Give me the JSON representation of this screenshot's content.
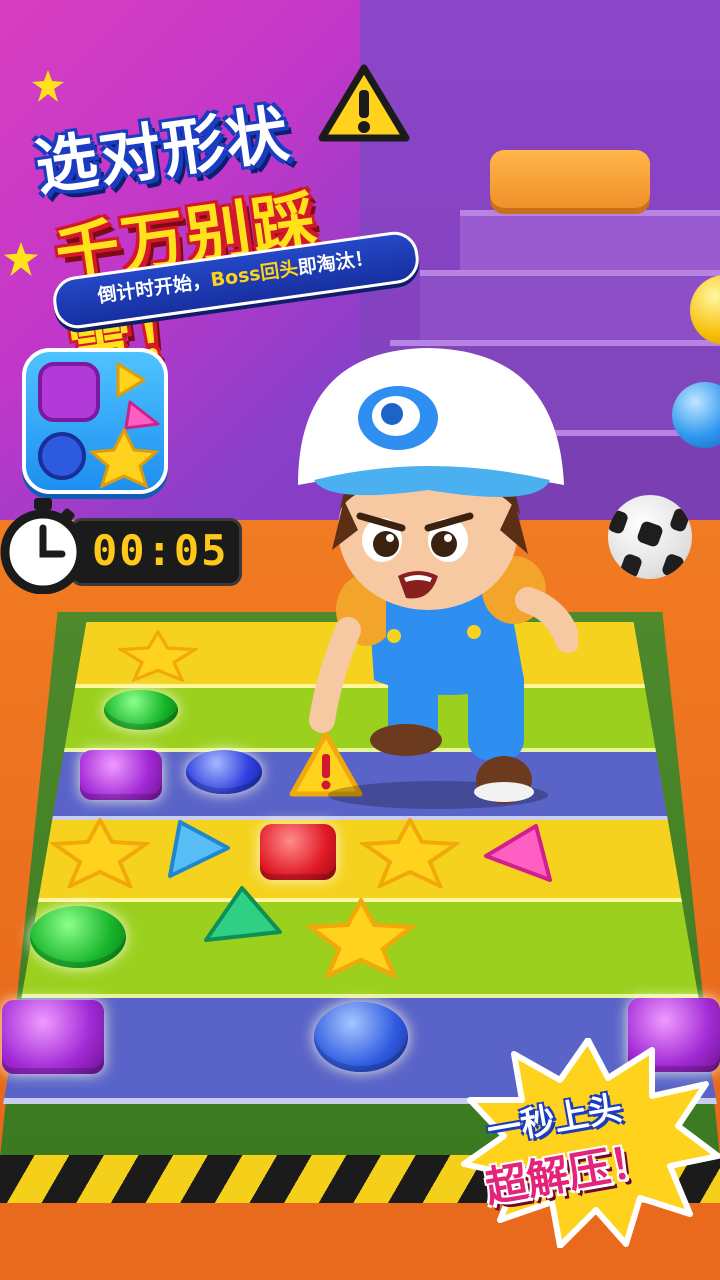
{
  "headline": {
    "line1": "选对形状",
    "line2": "千万别踩雷！",
    "subtitle_part1": "倒计时开始，",
    "subtitle_highlight": "Boss回头",
    "subtitle_part2": "即淘汰！"
  },
  "timer": {
    "display": "00:05",
    "icon": "stopwatch-icon"
  },
  "app_icon": {
    "icon": "shape-puzzle-app-icon"
  },
  "badge": {
    "line1": "一秒上头",
    "line2": "超解压！"
  },
  "board": {
    "rows": [
      {
        "color": "#f5d21e",
        "pieces": [
          "star-yellow"
        ]
      },
      {
        "color": "#9bd01e",
        "pieces": [
          "circle-green"
        ]
      },
      {
        "color": "#5a64c8",
        "pieces": [
          "square-purple",
          "circle-blue",
          "warning-triangle"
        ]
      },
      {
        "color": "#f5d21e",
        "pieces": [
          "star-yellow",
          "triangle-blue",
          "square-red",
          "star-yellow",
          "triangle-pink"
        ]
      },
      {
        "color": "#9bd01e",
        "pieces": [
          "circle-green",
          "triangle-teal",
          "star-yellow"
        ]
      },
      {
        "color": "#5a64c8",
        "pieces": [
          "square-purple",
          "circle-blue",
          "square-purple"
        ]
      }
    ]
  },
  "colors": {
    "title_blue": "#1a3cc0",
    "title_yellow": "#ffe21a",
    "title_red": "#d2182a",
    "timer_digits": "#ffc81a",
    "badge_pink": "#e4237a"
  }
}
